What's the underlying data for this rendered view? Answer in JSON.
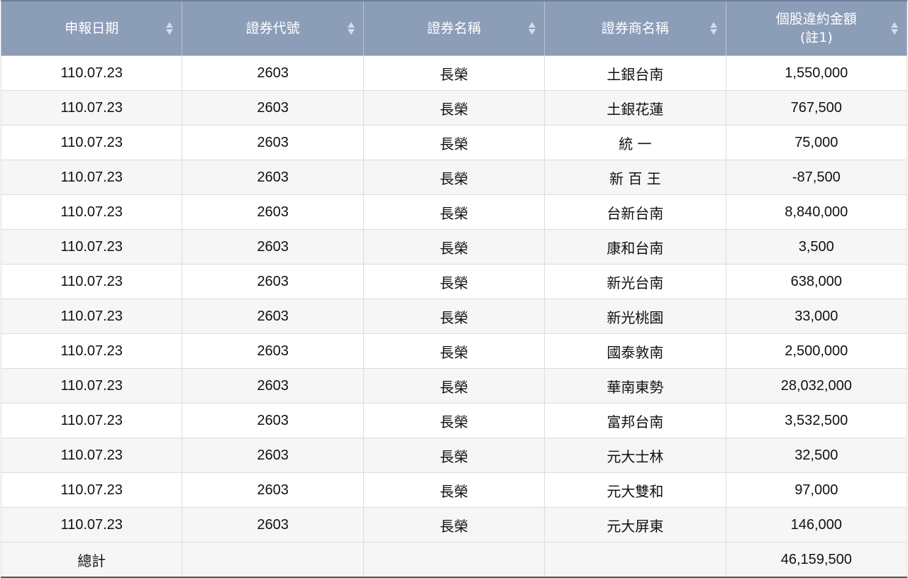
{
  "headers": [
    {
      "label": "申報日期",
      "sub": ""
    },
    {
      "label": "證券代號",
      "sub": ""
    },
    {
      "label": "證券名稱",
      "sub": ""
    },
    {
      "label": "證券商名稱",
      "sub": ""
    },
    {
      "label": "個股違約金額",
      "sub": "(註1)"
    }
  ],
  "rows": [
    {
      "date": "110.07.23",
      "code": "2603",
      "name": "長榮",
      "broker": "土銀台南",
      "amount": "1,550,000"
    },
    {
      "date": "110.07.23",
      "code": "2603",
      "name": "長榮",
      "broker": "土銀花蓮",
      "amount": "767,500"
    },
    {
      "date": "110.07.23",
      "code": "2603",
      "name": "長榮",
      "broker": "統 一",
      "amount": "75,000"
    },
    {
      "date": "110.07.23",
      "code": "2603",
      "name": "長榮",
      "broker": "新 百 王",
      "amount": "-87,500"
    },
    {
      "date": "110.07.23",
      "code": "2603",
      "name": "長榮",
      "broker": "台新台南",
      "amount": "8,840,000"
    },
    {
      "date": "110.07.23",
      "code": "2603",
      "name": "長榮",
      "broker": "康和台南",
      "amount": "3,500"
    },
    {
      "date": "110.07.23",
      "code": "2603",
      "name": "長榮",
      "broker": "新光台南",
      "amount": "638,000"
    },
    {
      "date": "110.07.23",
      "code": "2603",
      "name": "長榮",
      "broker": "新光桃園",
      "amount": "33,000"
    },
    {
      "date": "110.07.23",
      "code": "2603",
      "name": "長榮",
      "broker": "國泰敦南",
      "amount": "2,500,000"
    },
    {
      "date": "110.07.23",
      "code": "2603",
      "name": "長榮",
      "broker": "華南東勢",
      "amount": "28,032,000"
    },
    {
      "date": "110.07.23",
      "code": "2603",
      "name": "長榮",
      "broker": "富邦台南",
      "amount": "3,532,500"
    },
    {
      "date": "110.07.23",
      "code": "2603",
      "name": "長榮",
      "broker": "元大士林",
      "amount": "32,500"
    },
    {
      "date": "110.07.23",
      "code": "2603",
      "name": "長榮",
      "broker": "元大雙和",
      "amount": "97,000"
    },
    {
      "date": "110.07.23",
      "code": "2603",
      "name": "長榮",
      "broker": "元大屏東",
      "amount": "146,000"
    }
  ],
  "total": {
    "label": "總計",
    "amount": "46,159,500"
  },
  "colors": {
    "header_bg": "#8c9db8",
    "row_alt": "#f6f6f6"
  },
  "icons": {
    "sort": "sort-icon"
  }
}
